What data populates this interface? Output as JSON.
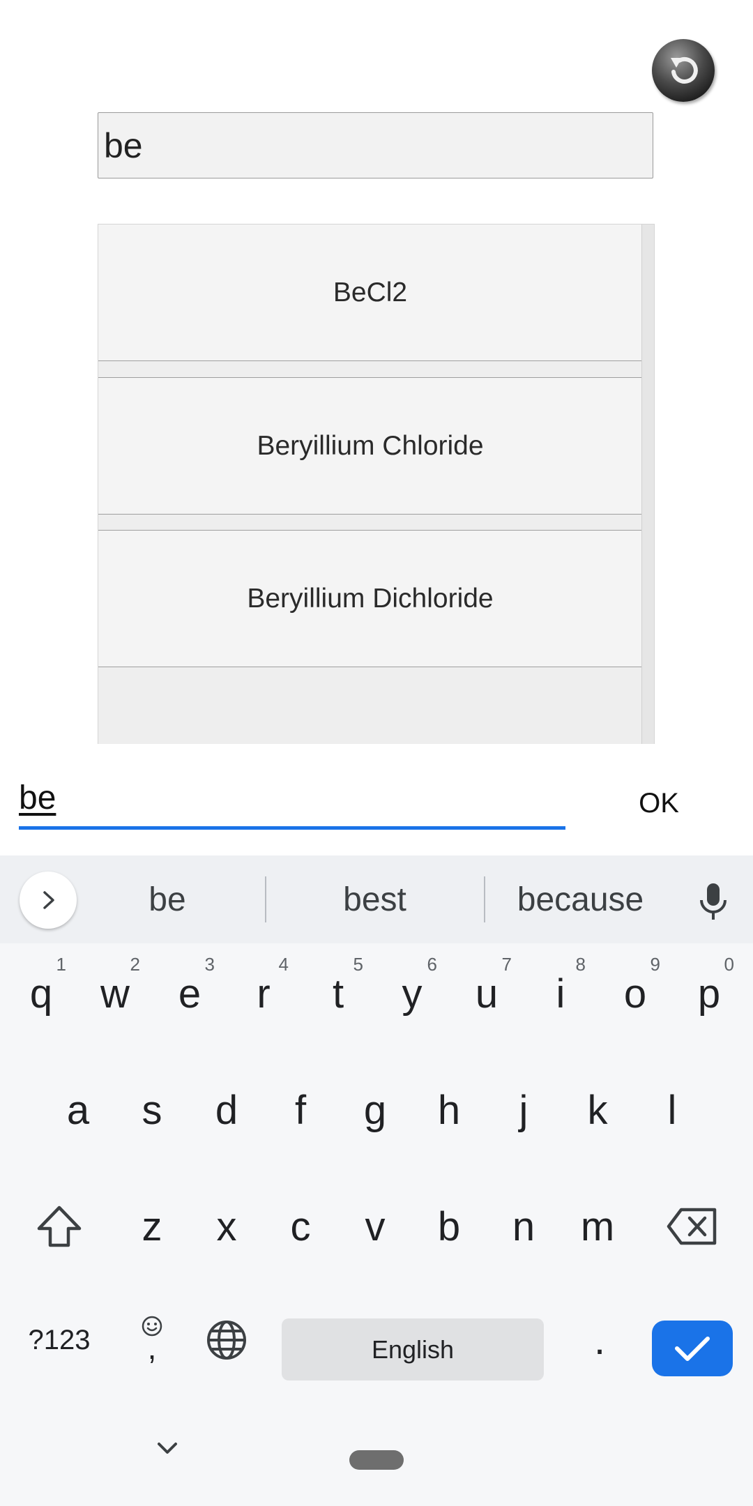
{
  "search": {
    "value": "be"
  },
  "results": [
    {
      "label": "BeCl2"
    },
    {
      "label": "Beryillium Chloride"
    },
    {
      "label": "Beryillium Dichloride"
    }
  ],
  "edit": {
    "value": "be",
    "ok_label": "OK"
  },
  "keyboard": {
    "suggestions": [
      "be",
      "best",
      "because"
    ],
    "row1": [
      {
        "key": "q",
        "hint": "1"
      },
      {
        "key": "w",
        "hint": "2"
      },
      {
        "key": "e",
        "hint": "3"
      },
      {
        "key": "r",
        "hint": "4"
      },
      {
        "key": "t",
        "hint": "5"
      },
      {
        "key": "y",
        "hint": "6"
      },
      {
        "key": "u",
        "hint": "7"
      },
      {
        "key": "i",
        "hint": "8"
      },
      {
        "key": "o",
        "hint": "9"
      },
      {
        "key": "p",
        "hint": "0"
      }
    ],
    "row2": [
      "a",
      "s",
      "d",
      "f",
      "g",
      "h",
      "j",
      "k",
      "l"
    ],
    "row3": [
      "z",
      "x",
      "c",
      "v",
      "b",
      "n",
      "m"
    ],
    "symbols_label": "?123",
    "comma_label": ",",
    "space_label": "English",
    "period_label": ".",
    "accent_color": "#1a73e8"
  }
}
